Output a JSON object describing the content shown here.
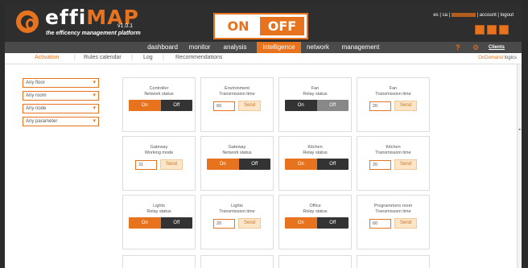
{
  "app": {
    "brand_prefix": "effi",
    "brand_suffix": "MAP",
    "version": "v1.0.1",
    "tagline": "the efficency management platform",
    "switch_on": "ON",
    "switch_off": "OFF"
  },
  "toplinks": {
    "lang_es": "es",
    "sep1": "|",
    "lang_ca": "ca",
    "sep2": "|",
    "sep3": "|",
    "account": "account",
    "sep4": "|",
    "logout": "logout"
  },
  "nav": {
    "items": [
      "dashboard",
      "monitor",
      "analysis",
      "intelligence",
      "network",
      "management"
    ],
    "active_index": 3,
    "help": "?",
    "clients": "Clients"
  },
  "subnav": {
    "items": [
      "Activation",
      "Rules calendar",
      "Log",
      "Recommendations"
    ],
    "active_index": 0,
    "separator": "|",
    "ondemand_prefix": "OnDemand",
    "ondemand_suffix": "logics"
  },
  "filters": [
    "Any floor",
    "Any room",
    "Any node",
    "Any parameter"
  ],
  "cards": [
    {
      "title": "Controller",
      "subtitle": "Network status",
      "kind": "toggle",
      "state": "on",
      "on_label": "On",
      "off_label": "Off"
    },
    {
      "title": "Environment",
      "subtitle": "Transmission time",
      "kind": "input",
      "value": "60",
      "send_label": "Send"
    },
    {
      "title": "Fan",
      "subtitle": "Relay status",
      "kind": "toggle",
      "state": "off",
      "on_label": "On",
      "off_label": "Off"
    },
    {
      "title": "Fan",
      "subtitle": "Transmission time",
      "kind": "input",
      "value": "20",
      "send_label": "Send"
    },
    {
      "title": "Gateway",
      "subtitle": "Working mode",
      "kind": "input",
      "value": "31",
      "send_label": "Send"
    },
    {
      "title": "Gateway",
      "subtitle": "Network status",
      "kind": "toggle",
      "state": "on",
      "on_label": "On",
      "off_label": "Off"
    },
    {
      "title": "Kitchen",
      "subtitle": "Relay status",
      "kind": "toggle",
      "state": "on",
      "on_label": "On",
      "off_label": "Off"
    },
    {
      "title": "Kitchen",
      "subtitle": "Transmission time",
      "kind": "input",
      "value": "20",
      "send_label": "Send"
    },
    {
      "title": "Lights",
      "subtitle": "Relay status",
      "kind": "toggle",
      "state": "on",
      "on_label": "On",
      "off_label": "Off"
    },
    {
      "title": "Lights",
      "subtitle": "Transmission time",
      "kind": "input",
      "value": "20",
      "send_label": "Send"
    },
    {
      "title": "Office",
      "subtitle": "Relay status",
      "kind": "toggle",
      "state": "on",
      "on_label": "On",
      "off_label": "Off"
    },
    {
      "title": "Programmers room",
      "subtitle": "Transmission time",
      "kind": "input",
      "value": "60",
      "send_label": "Send"
    }
  ],
  "colors": {
    "accent": "#e8731f",
    "dark": "#2e2e2e",
    "nav": "#4a4a4a"
  },
  "icons": [
    "logo-mark-icon",
    "user-icon",
    "power-icon",
    "building-icon",
    "help-icon",
    "gear-icon"
  ]
}
